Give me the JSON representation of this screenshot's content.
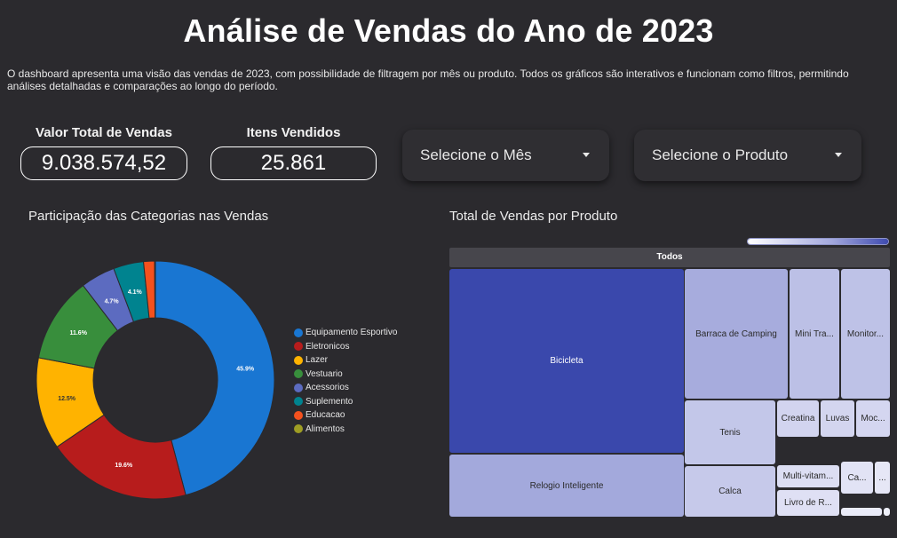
{
  "header": {
    "title": "Análise de Vendas do Ano de 2023",
    "description": "O dashboard apresenta uma visão das vendas de 2023, com possibilidade de filtragem por mês ou produto. Todos os gráficos são interativos e funcionam como filtros, permitindo análises detalhadas e comparações ao longo do período."
  },
  "kpis": {
    "total_sales_label": "Valor Total de Vendas",
    "total_sales_value": "9.038.574,52",
    "items_sold_label": "Itens Vendidos",
    "items_sold_value": "25.861"
  },
  "filters": {
    "month_placeholder": "Selecione o Mês",
    "product_placeholder": "Selecione o Produto"
  },
  "donut": {
    "title": "Participação das Categorias nas Vendas"
  },
  "treemap": {
    "title": "Total de Vendas por Produto",
    "root_label": "Todos",
    "tiles": [
      {
        "label": "Bicicleta",
        "color": "#3a48ac",
        "text_color": "#ffffff"
      },
      {
        "label": "Relogio Inteligente",
        "color": "#a3a9dc",
        "text_color": "#2b2b2b"
      },
      {
        "label": "Barraca de Camping",
        "color": "#a7acdd",
        "text_color": "#2b2b2b"
      },
      {
        "label": "Mini Tra...",
        "color": "#bcc0e6",
        "text_color": "#2b2b2b"
      },
      {
        "label": "Monitor...",
        "color": "#bec2e7",
        "text_color": "#2b2b2b"
      },
      {
        "label": "Tenis",
        "color": "#c3c7e9",
        "text_color": "#2b2b2b"
      },
      {
        "label": "Calca",
        "color": "#c6c9ea",
        "text_color": "#2b2b2b"
      },
      {
        "label": "Creatina",
        "color": "#d2d4ef",
        "text_color": "#2b2b2b"
      },
      {
        "label": "Luvas",
        "color": "#d3d5ef",
        "text_color": "#2b2b2b"
      },
      {
        "label": "Moc...",
        "color": "#d4d6f0",
        "text_color": "#2b2b2b"
      },
      {
        "label": "Multi-vitam...",
        "color": "#dcdef3",
        "text_color": "#2b2b2b"
      },
      {
        "label": "Livro de R...",
        "color": "#dfe0f4",
        "text_color": "#2b2b2b"
      },
      {
        "label": "Ca...",
        "color": "#e2e3f5",
        "text_color": "#2b2b2b"
      },
      {
        "label": "...",
        "color": "#e6e7f6",
        "text_color": "#2b2b2b"
      },
      {
        "label": "",
        "color": "#eaebf8",
        "text_color": "#2b2b2b"
      },
      {
        "label": "",
        "color": "#eeeff9",
        "text_color": "#2b2b2b"
      }
    ]
  },
  "chart_data": {
    "type": "pie",
    "title": "Participação das Categorias nas Vendas",
    "categories": [
      "Equipamento Esportivo",
      "Eletronicos",
      "Lazer",
      "Vestuario",
      "Acessorios",
      "Suplemento",
      "Educacao",
      "Alimentos"
    ],
    "values": [
      45.9,
      19.6,
      12.5,
      11.6,
      4.7,
      4.1,
      1.5,
      0.1
    ],
    "labels": [
      "45.9%",
      "19.6%",
      "12.5%",
      "11.6%",
      "4.7%",
      "4.1%",
      "",
      ""
    ],
    "colors": [
      "#1976d2",
      "#b71c1c",
      "#ffb300",
      "#388e3c",
      "#5c6bc0",
      "#00838f",
      "#f4511e",
      "#9e9d24"
    ],
    "legend_position": "right"
  }
}
